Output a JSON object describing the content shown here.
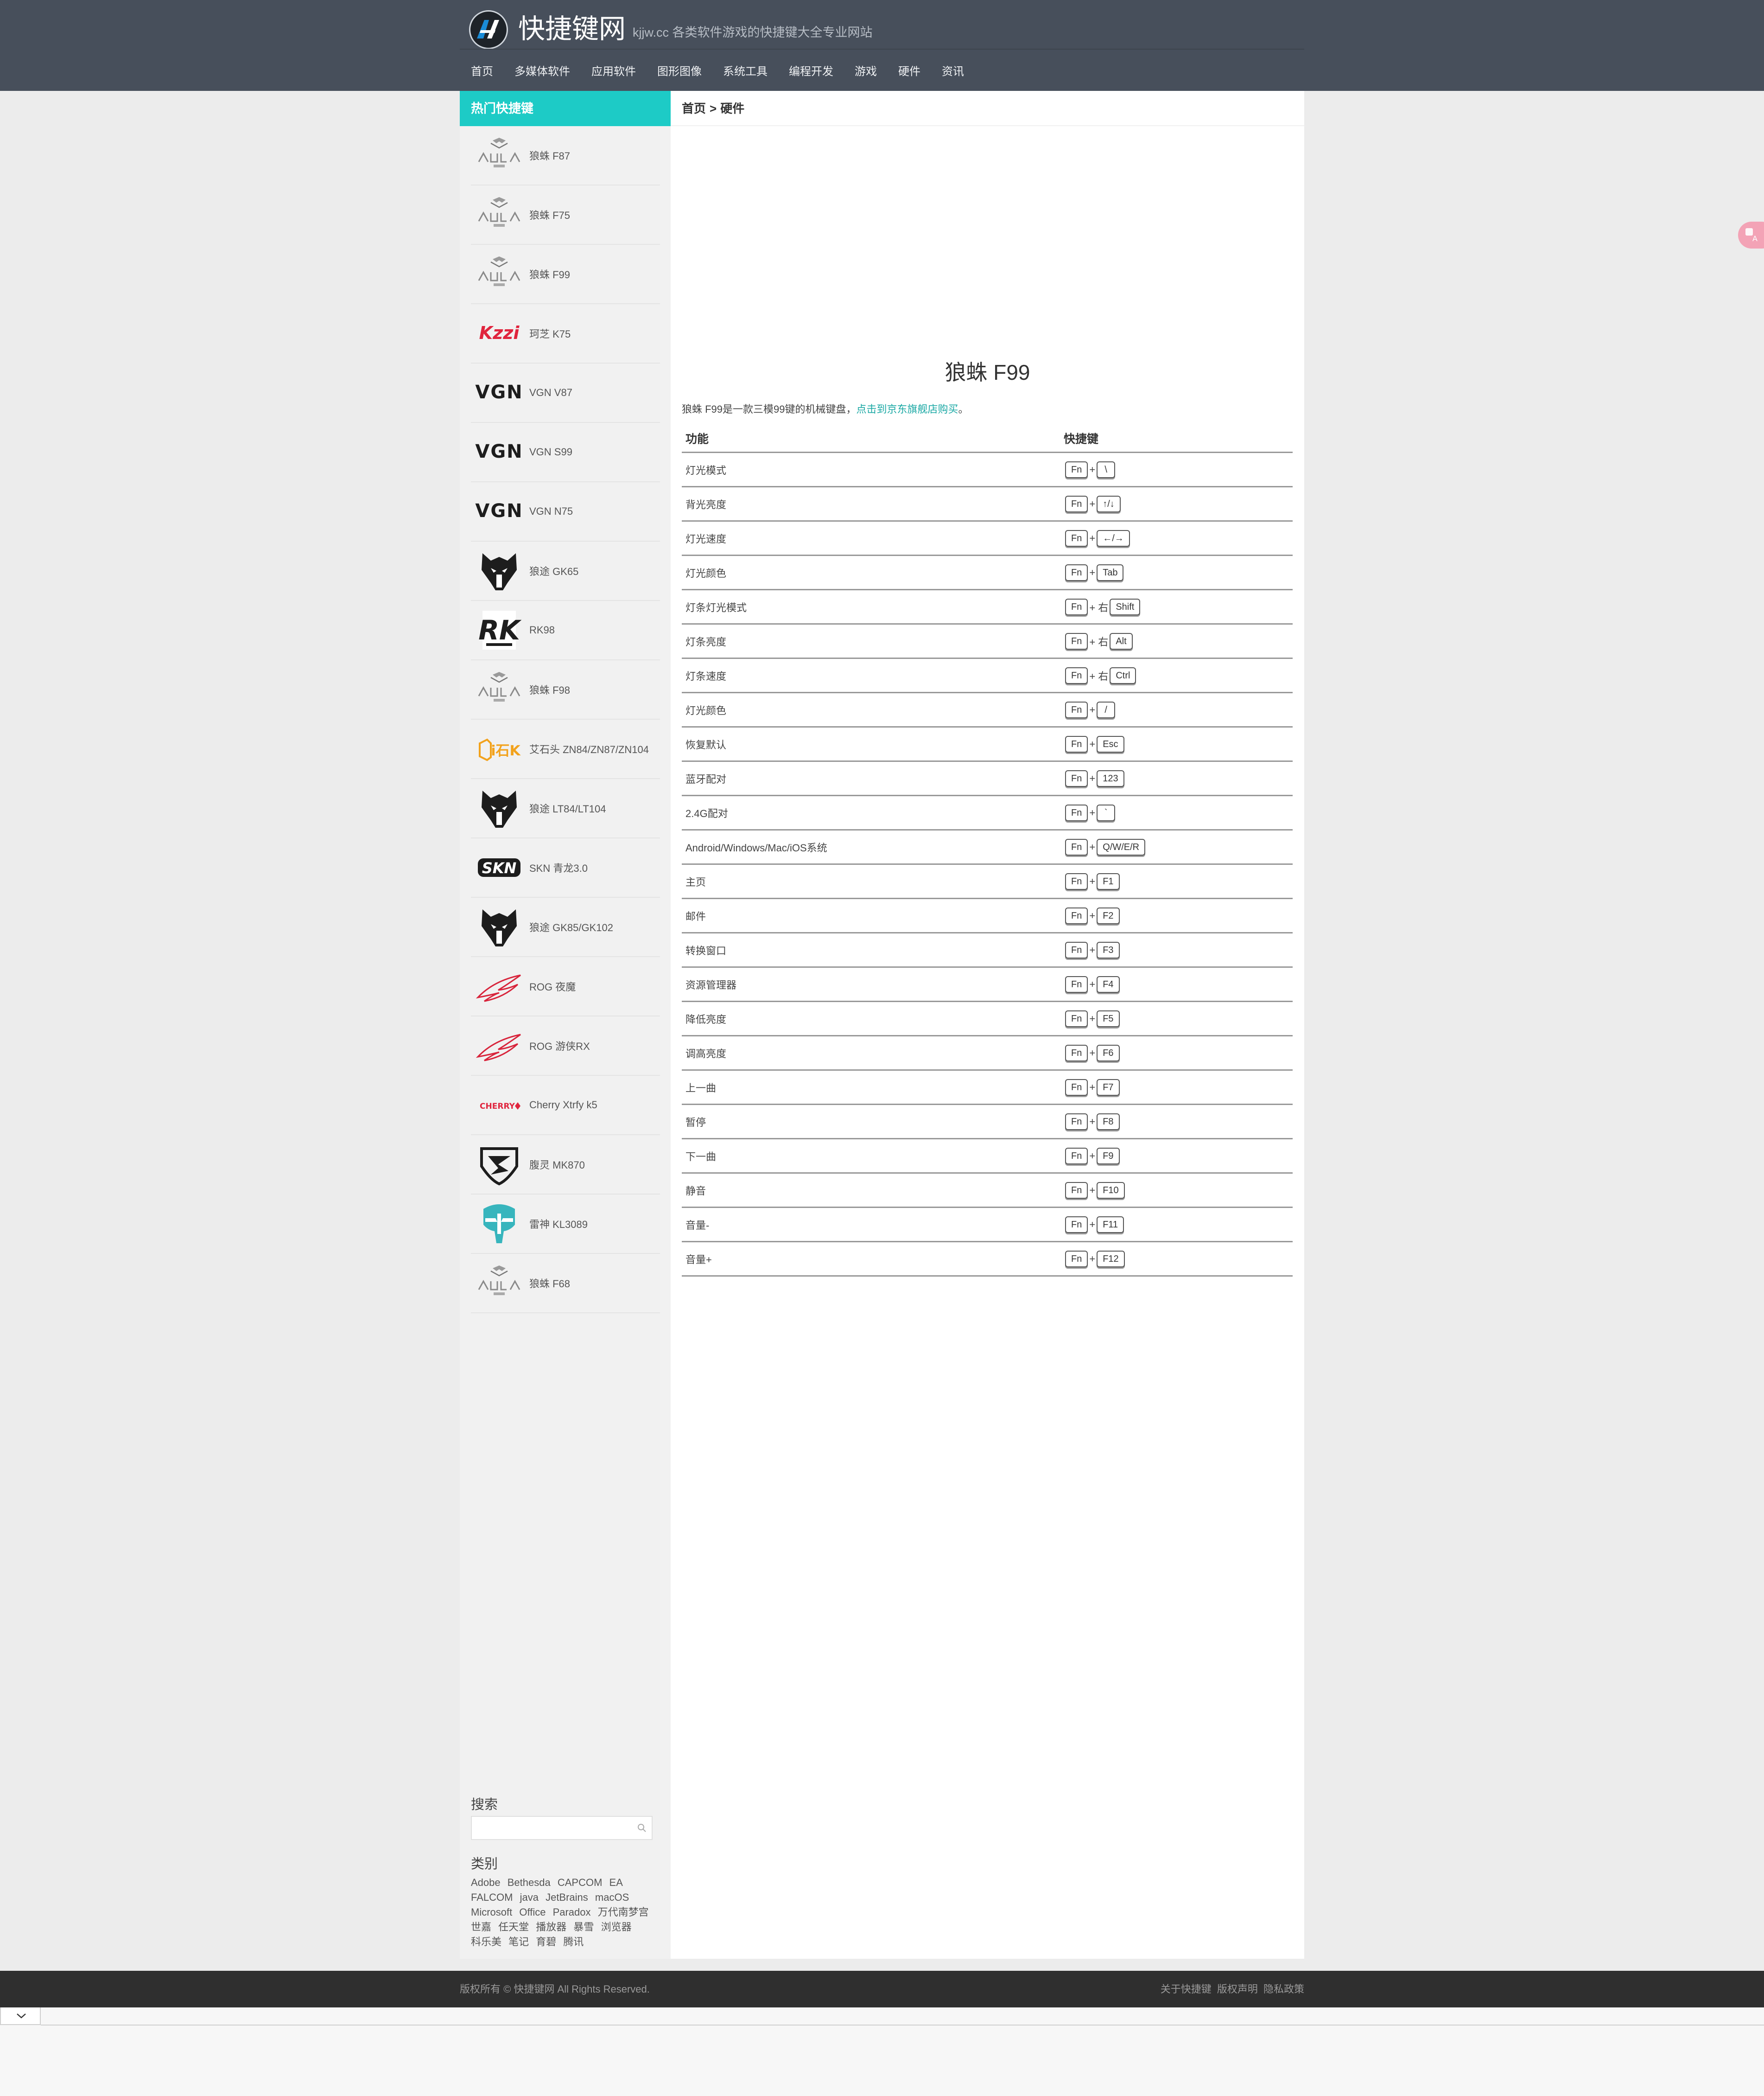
{
  "header": {
    "site_title": "快捷键网",
    "site_subtitle": "kjjw.cc 各类软件游戏的快捷键大全专业网站",
    "nav": [
      "首页",
      "多媒体软件",
      "应用软件",
      "图形图像",
      "系统工具",
      "编程开发",
      "游戏",
      "硬件",
      "资讯"
    ]
  },
  "sidebar": {
    "heading": "热门快捷键",
    "items": [
      {
        "name": "狼蛛 F87",
        "icon": "aula-logo-icon"
      },
      {
        "name": "狼蛛 F75",
        "icon": "aula-logo-icon"
      },
      {
        "name": "狼蛛 F99",
        "icon": "aula-logo-icon"
      },
      {
        "name": "珂芝 K75",
        "icon": "kzzi-logo-icon",
        "logo_text": "Kzzi"
      },
      {
        "name": "VGN V87",
        "icon": "vgn-logo-icon",
        "logo_text": "VGN"
      },
      {
        "name": "VGN S99",
        "icon": "vgn-logo-icon",
        "logo_text": "VGN"
      },
      {
        "name": "VGN N75",
        "icon": "vgn-logo-icon",
        "logo_text": "VGN"
      },
      {
        "name": "狼途 GK65",
        "icon": "langtu-logo-icon"
      },
      {
        "name": "RK98",
        "icon": "rk-logo-icon",
        "logo_text": "RK"
      },
      {
        "name": "狼蛛 F98",
        "icon": "aula-logo-icon"
      },
      {
        "name": "艾石头 ZN84/ZN87/ZN104",
        "icon": "ai-stone-logo-icon",
        "logo_text": "i石K"
      },
      {
        "name": "狼途 LT84/LT104",
        "icon": "langtu-logo-icon"
      },
      {
        "name": "SKN 青龙3.0",
        "icon": "skn-logo-icon",
        "logo_text": "SKN"
      },
      {
        "name": "狼途 GK85/GK102",
        "icon": "langtu-logo-icon"
      },
      {
        "name": "ROG 夜魔",
        "icon": "rog-logo-icon"
      },
      {
        "name": "ROG 游侠RX",
        "icon": "rog-logo-icon"
      },
      {
        "name": "Cherry Xtrfy k5",
        "icon": "cherry-logo-icon",
        "logo_text": "CHERRY"
      },
      {
        "name": "腹灵 MK870",
        "icon": "fuling-logo-icon"
      },
      {
        "name": "雷神 KL3089",
        "icon": "thunderobot-logo-icon"
      },
      {
        "name": "狼蛛 F68",
        "icon": "aula-logo-icon"
      }
    ],
    "search_title": "搜索",
    "search_placeholder": "",
    "category_title": "类别",
    "categories": [
      "Adobe",
      "Bethesda",
      "CAPCOM",
      "EA",
      "FALCOM",
      "java",
      "JetBrains",
      "macOS",
      "Microsoft",
      "Office",
      "Paradox",
      "万代南梦宫",
      "世嘉",
      "任天堂",
      "播放器",
      "暴雪",
      "浏览器",
      "科乐美",
      "笔记",
      "育碧",
      "腾讯"
    ]
  },
  "main": {
    "breadcrumb_home": "首页",
    "breadcrumb_sep": ">",
    "breadcrumb_current": "硬件",
    "title": "狼蛛 F99",
    "intro_text": "狼蛛 F99是一款三模99键的机械键盘，",
    "intro_link": "点击到京东旗舰店购买",
    "intro_end": "。",
    "table_headers": {
      "function": "功能",
      "shortcut": "快捷键"
    },
    "rows": [
      {
        "func": "灯光模式",
        "keys": [
          "Fn",
          "+",
          "\\"
        ]
      },
      {
        "func": "背光亮度",
        "keys": [
          "Fn",
          "+",
          "↑/↓"
        ]
      },
      {
        "func": "灯光速度",
        "keys": [
          "Fn",
          "+",
          "←/→"
        ]
      },
      {
        "func": "灯光颜色",
        "keys": [
          "Fn",
          "+",
          "Tab"
        ]
      },
      {
        "func": "灯条灯光模式",
        "keys": [
          "Fn",
          "+ 右",
          "Shift"
        ]
      },
      {
        "func": "灯条亮度",
        "keys": [
          "Fn",
          "+ 右",
          "Alt"
        ]
      },
      {
        "func": "灯条速度",
        "keys": [
          "Fn",
          "+ 右",
          "Ctrl"
        ]
      },
      {
        "func": "灯光颜色",
        "keys": [
          "Fn",
          "+",
          "/"
        ]
      },
      {
        "func": "恢复默认",
        "keys": [
          "Fn",
          "+",
          "Esc"
        ]
      },
      {
        "func": "蓝牙配对",
        "keys": [
          "Fn",
          "+",
          "123"
        ]
      },
      {
        "func": "2.4G配对",
        "keys": [
          "Fn",
          "+",
          "`"
        ]
      },
      {
        "func": "Android/Windows/Mac/iOS系统",
        "keys": [
          "Fn",
          "+",
          "Q/W/E/R"
        ]
      },
      {
        "func": "主页",
        "keys": [
          "Fn",
          "+",
          "F1"
        ]
      },
      {
        "func": "邮件",
        "keys": [
          "Fn",
          "+",
          "F2"
        ]
      },
      {
        "func": "转换窗口",
        "keys": [
          "Fn",
          "+",
          "F3"
        ]
      },
      {
        "func": "资源管理器",
        "keys": [
          "Fn",
          "+",
          "F4"
        ]
      },
      {
        "func": "降低亮度",
        "keys": [
          "Fn",
          "+",
          "F5"
        ]
      },
      {
        "func": "调高亮度",
        "keys": [
          "Fn",
          "+",
          "F6"
        ]
      },
      {
        "func": "上一曲",
        "keys": [
          "Fn",
          "+",
          "F7"
        ]
      },
      {
        "func": "暂停",
        "keys": [
          "Fn",
          "+",
          "F8"
        ]
      },
      {
        "func": "下一曲",
        "keys": [
          "Fn",
          "+",
          "F9"
        ]
      },
      {
        "func": "静音",
        "keys": [
          "Fn",
          "+",
          "F10"
        ]
      },
      {
        "func": "音量-",
        "keys": [
          "Fn",
          "+",
          "F11"
        ]
      },
      {
        "func": "音量+",
        "keys": [
          "Fn",
          "+",
          "F12"
        ]
      }
    ]
  },
  "footer": {
    "copyright": "版权所有 © 快捷键网 All Rights Reserved.",
    "links": [
      "关于快捷键",
      "版权声明",
      "隐私政策"
    ]
  },
  "colors": {
    "header_bg": "#474f5b",
    "accent": "#1dcbc6",
    "link": "#1aa8a4",
    "footer_bg": "#2f2f2f"
  }
}
